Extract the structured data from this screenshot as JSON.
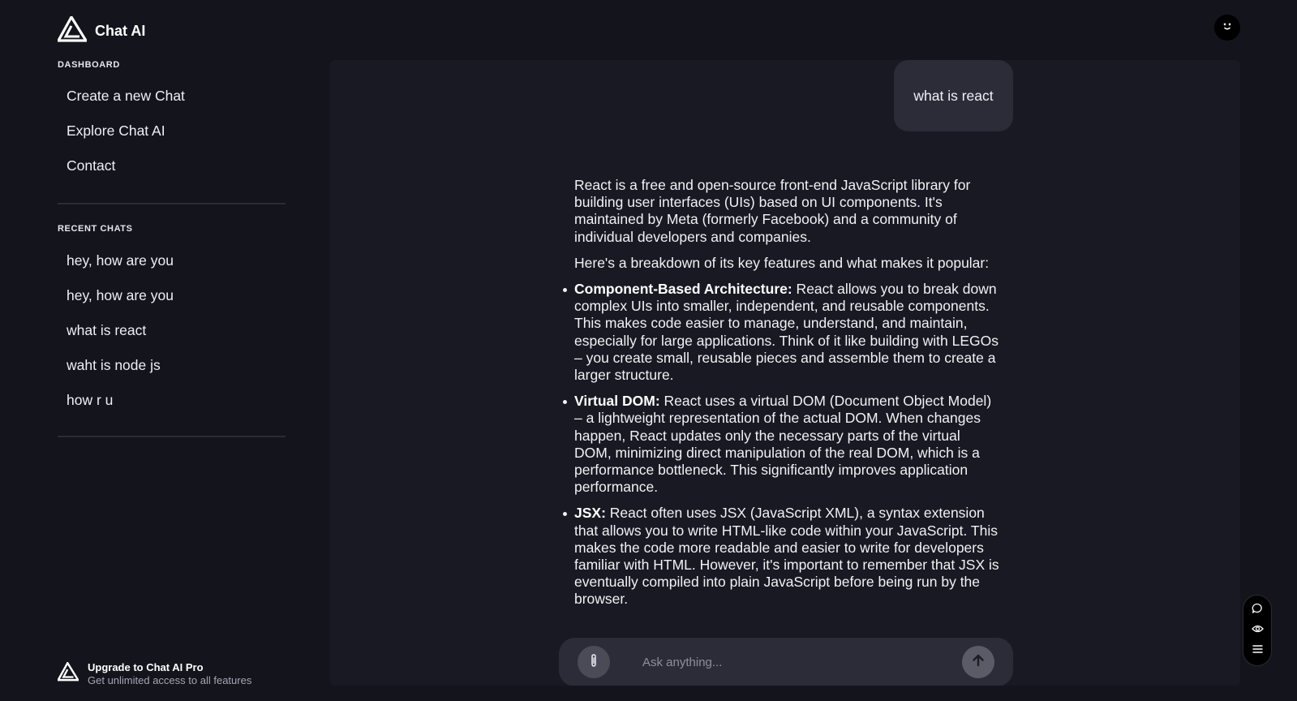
{
  "app": {
    "title": "Chat AI"
  },
  "sidebar": {
    "dashboard_label": "DASHBOARD",
    "nav": [
      {
        "label": "Create a new Chat"
      },
      {
        "label": "Explore Chat AI"
      },
      {
        "label": "Contact"
      }
    ],
    "recent_label": "RECENT CHATS",
    "recent": [
      {
        "label": "hey, how are you"
      },
      {
        "label": "hey, how are you"
      },
      {
        "label": "what is react"
      },
      {
        "label": "waht is node js"
      },
      {
        "label": "how r u"
      }
    ],
    "upgrade": {
      "title": "Upgrade to Chat AI Pro",
      "subtitle": "Get unlimited access to all features"
    }
  },
  "conversation": {
    "user_message": "what is react",
    "answer": {
      "intro": "React is a free and open-source front-end JavaScript library for building user interfaces (UIs) based on UI components. It's maintained by Meta (formerly Facebook) and a community of individual developers and companies.",
      "lead": "Here's a breakdown of its key features and what makes it popular:",
      "features": [
        {
          "term": "Component-Based Architecture:",
          "text": " React allows you to break down complex UIs into smaller, independent, and reusable components. This makes code easier to manage, understand, and maintain, especially for large applications. Think of it like building with LEGOs – you create small, reusable pieces and assemble them to create a larger structure."
        },
        {
          "term": "Virtual DOM:",
          "text": " React uses a virtual DOM (Document Object Model) – a lightweight representation of the actual DOM. When changes happen, React updates only the necessary parts of the virtual DOM, minimizing direct manipulation of the real DOM, which is a performance bottleneck. This significantly improves application performance."
        },
        {
          "term": "JSX:",
          "text": " React often uses JSX (JavaScript XML), a syntax extension that allows you to write HTML-like code within your JavaScript. This makes the code more readable and easier to write for developers familiar with HTML. However, it's important to remember that JSX is eventually compiled into plain JavaScript before being run by the browser."
        }
      ]
    }
  },
  "composer": {
    "placeholder": "Ask anything..."
  },
  "icons": {
    "logo": "triangle-logo-icon",
    "avatar": "smiley-face-icon",
    "attach": "paperclip-icon",
    "send": "arrow-up-icon",
    "toolbar": [
      "chat-bubble-icon",
      "eye-icon",
      "menu-icon"
    ]
  },
  "colors": {
    "background": "#13141c",
    "panel": "#181922",
    "bubble": "#2b2c38",
    "text": "#e8e9ee"
  }
}
